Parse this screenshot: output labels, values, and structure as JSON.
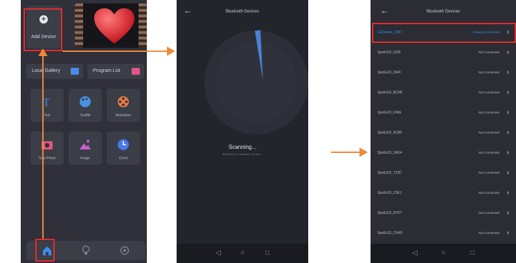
{
  "screen1": {
    "add_device_label": "Add Device",
    "local_gallery_label": "Local Gallery",
    "program_list_label": "Program List",
    "tiles": [
      {
        "label": "Text",
        "icon": "text-icon",
        "color": "#3a8cf0"
      },
      {
        "label": "Graffiti",
        "icon": "palette-icon",
        "color": "#4a90e0"
      },
      {
        "label": "Animation",
        "icon": "film-reel-icon",
        "color": "#e07a4a"
      },
      {
        "label": "Take Photo",
        "icon": "camera-icon",
        "color": "#e0557a"
      },
      {
        "label": "Image",
        "icon": "image-icon",
        "color": "#c860c8"
      },
      {
        "label": "Clock",
        "icon": "clock-icon",
        "color": "#4a78e8"
      }
    ],
    "tabbar": [
      "home-icon",
      "bulb-icon",
      "settings-icon"
    ]
  },
  "screen2": {
    "title": "Bluetooth Devices",
    "scanning_title": "Scanning...",
    "scanning_subtitle": "Searching for available devices..."
  },
  "screen3": {
    "title": "Bluetooth Devices",
    "devices": [
      {
        "name": "LEDsaver_2657",
        "status": "Already Connected",
        "active": true
      },
      {
        "name": "SpotLED_023F",
        "status": "Not Connected",
        "active": false
      },
      {
        "name": "SpotLED_364C",
        "status": "Not Connected",
        "active": false
      },
      {
        "name": "SpotLED_BC6B",
        "status": "Not Connected",
        "active": false
      },
      {
        "name": "SpotLED_F666",
        "status": "Not Connected",
        "active": false
      },
      {
        "name": "SpotLED_6C88",
        "status": "Not Connected",
        "active": false
      },
      {
        "name": "SpotLED_2AD4",
        "status": "Not Connected",
        "active": false
      },
      {
        "name": "SpotLED_723D",
        "status": "Not Connected",
        "active": false
      },
      {
        "name": "SpotLED_C5E1",
        "status": "Not Connected",
        "active": false
      },
      {
        "name": "SpotLED_B7D7",
        "status": "Not Connected",
        "active": false
      },
      {
        "name": "SpotLED_CA4D",
        "status": "Not Connected",
        "active": false
      }
    ]
  },
  "colors": {
    "highlight": "#e52b2b",
    "arrow": "#f08a3a",
    "accent": "#3a8cf0"
  }
}
